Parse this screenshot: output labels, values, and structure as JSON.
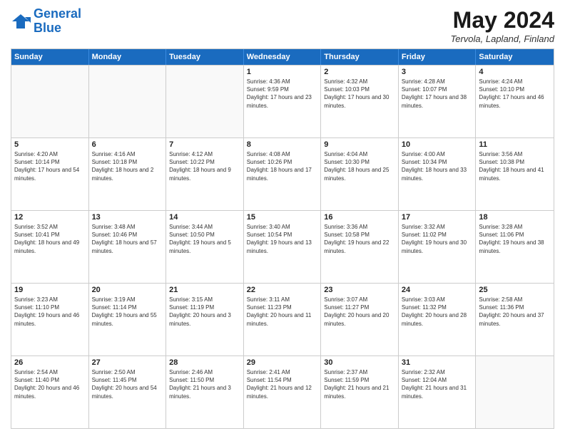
{
  "header": {
    "logo_line1": "General",
    "logo_line2": "Blue",
    "month": "May 2024",
    "location": "Tervola, Lapland, Finland"
  },
  "days_of_week": [
    "Sunday",
    "Monday",
    "Tuesday",
    "Wednesday",
    "Thursday",
    "Friday",
    "Saturday"
  ],
  "weeks": [
    [
      {
        "day": "",
        "sunrise": "",
        "sunset": "",
        "daylight": ""
      },
      {
        "day": "",
        "sunrise": "",
        "sunset": "",
        "daylight": ""
      },
      {
        "day": "",
        "sunrise": "",
        "sunset": "",
        "daylight": ""
      },
      {
        "day": "1",
        "sunrise": "Sunrise: 4:36 AM",
        "sunset": "Sunset: 9:59 PM",
        "daylight": "Daylight: 17 hours and 23 minutes."
      },
      {
        "day": "2",
        "sunrise": "Sunrise: 4:32 AM",
        "sunset": "Sunset: 10:03 PM",
        "daylight": "Daylight: 17 hours and 30 minutes."
      },
      {
        "day": "3",
        "sunrise": "Sunrise: 4:28 AM",
        "sunset": "Sunset: 10:07 PM",
        "daylight": "Daylight: 17 hours and 38 minutes."
      },
      {
        "day": "4",
        "sunrise": "Sunrise: 4:24 AM",
        "sunset": "Sunset: 10:10 PM",
        "daylight": "Daylight: 17 hours and 46 minutes."
      }
    ],
    [
      {
        "day": "5",
        "sunrise": "Sunrise: 4:20 AM",
        "sunset": "Sunset: 10:14 PM",
        "daylight": "Daylight: 17 hours and 54 minutes."
      },
      {
        "day": "6",
        "sunrise": "Sunrise: 4:16 AM",
        "sunset": "Sunset: 10:18 PM",
        "daylight": "Daylight: 18 hours and 2 minutes."
      },
      {
        "day": "7",
        "sunrise": "Sunrise: 4:12 AM",
        "sunset": "Sunset: 10:22 PM",
        "daylight": "Daylight: 18 hours and 9 minutes."
      },
      {
        "day": "8",
        "sunrise": "Sunrise: 4:08 AM",
        "sunset": "Sunset: 10:26 PM",
        "daylight": "Daylight: 18 hours and 17 minutes."
      },
      {
        "day": "9",
        "sunrise": "Sunrise: 4:04 AM",
        "sunset": "Sunset: 10:30 PM",
        "daylight": "Daylight: 18 hours and 25 minutes."
      },
      {
        "day": "10",
        "sunrise": "Sunrise: 4:00 AM",
        "sunset": "Sunset: 10:34 PM",
        "daylight": "Daylight: 18 hours and 33 minutes."
      },
      {
        "day": "11",
        "sunrise": "Sunrise: 3:56 AM",
        "sunset": "Sunset: 10:38 PM",
        "daylight": "Daylight: 18 hours and 41 minutes."
      }
    ],
    [
      {
        "day": "12",
        "sunrise": "Sunrise: 3:52 AM",
        "sunset": "Sunset: 10:41 PM",
        "daylight": "Daylight: 18 hours and 49 minutes."
      },
      {
        "day": "13",
        "sunrise": "Sunrise: 3:48 AM",
        "sunset": "Sunset: 10:46 PM",
        "daylight": "Daylight: 18 hours and 57 minutes."
      },
      {
        "day": "14",
        "sunrise": "Sunrise: 3:44 AM",
        "sunset": "Sunset: 10:50 PM",
        "daylight": "Daylight: 19 hours and 5 minutes."
      },
      {
        "day": "15",
        "sunrise": "Sunrise: 3:40 AM",
        "sunset": "Sunset: 10:54 PM",
        "daylight": "Daylight: 19 hours and 13 minutes."
      },
      {
        "day": "16",
        "sunrise": "Sunrise: 3:36 AM",
        "sunset": "Sunset: 10:58 PM",
        "daylight": "Daylight: 19 hours and 22 minutes."
      },
      {
        "day": "17",
        "sunrise": "Sunrise: 3:32 AM",
        "sunset": "Sunset: 11:02 PM",
        "daylight": "Daylight: 19 hours and 30 minutes."
      },
      {
        "day": "18",
        "sunrise": "Sunrise: 3:28 AM",
        "sunset": "Sunset: 11:06 PM",
        "daylight": "Daylight: 19 hours and 38 minutes."
      }
    ],
    [
      {
        "day": "19",
        "sunrise": "Sunrise: 3:23 AM",
        "sunset": "Sunset: 11:10 PM",
        "daylight": "Daylight: 19 hours and 46 minutes."
      },
      {
        "day": "20",
        "sunrise": "Sunrise: 3:19 AM",
        "sunset": "Sunset: 11:14 PM",
        "daylight": "Daylight: 19 hours and 55 minutes."
      },
      {
        "day": "21",
        "sunrise": "Sunrise: 3:15 AM",
        "sunset": "Sunset: 11:19 PM",
        "daylight": "Daylight: 20 hours and 3 minutes."
      },
      {
        "day": "22",
        "sunrise": "Sunrise: 3:11 AM",
        "sunset": "Sunset: 11:23 PM",
        "daylight": "Daylight: 20 hours and 11 minutes."
      },
      {
        "day": "23",
        "sunrise": "Sunrise: 3:07 AM",
        "sunset": "Sunset: 11:27 PM",
        "daylight": "Daylight: 20 hours and 20 minutes."
      },
      {
        "day": "24",
        "sunrise": "Sunrise: 3:03 AM",
        "sunset": "Sunset: 11:32 PM",
        "daylight": "Daylight: 20 hours and 28 minutes."
      },
      {
        "day": "25",
        "sunrise": "Sunrise: 2:58 AM",
        "sunset": "Sunset: 11:36 PM",
        "daylight": "Daylight: 20 hours and 37 minutes."
      }
    ],
    [
      {
        "day": "26",
        "sunrise": "Sunrise: 2:54 AM",
        "sunset": "Sunset: 11:40 PM",
        "daylight": "Daylight: 20 hours and 46 minutes."
      },
      {
        "day": "27",
        "sunrise": "Sunrise: 2:50 AM",
        "sunset": "Sunset: 11:45 PM",
        "daylight": "Daylight: 20 hours and 54 minutes."
      },
      {
        "day": "28",
        "sunrise": "Sunrise: 2:46 AM",
        "sunset": "Sunset: 11:50 PM",
        "daylight": "Daylight: 21 hours and 3 minutes."
      },
      {
        "day": "29",
        "sunrise": "Sunrise: 2:41 AM",
        "sunset": "Sunset: 11:54 PM",
        "daylight": "Daylight: 21 hours and 12 minutes."
      },
      {
        "day": "30",
        "sunrise": "Sunrise: 2:37 AM",
        "sunset": "Sunset: 11:59 PM",
        "daylight": "Daylight: 21 hours and 21 minutes."
      },
      {
        "day": "31",
        "sunrise": "Sunrise: 2:32 AM",
        "sunset": "Sunset: 12:04 AM",
        "daylight": "Daylight: 21 hours and 31 minutes."
      },
      {
        "day": "",
        "sunrise": "",
        "sunset": "",
        "daylight": ""
      }
    ]
  ]
}
